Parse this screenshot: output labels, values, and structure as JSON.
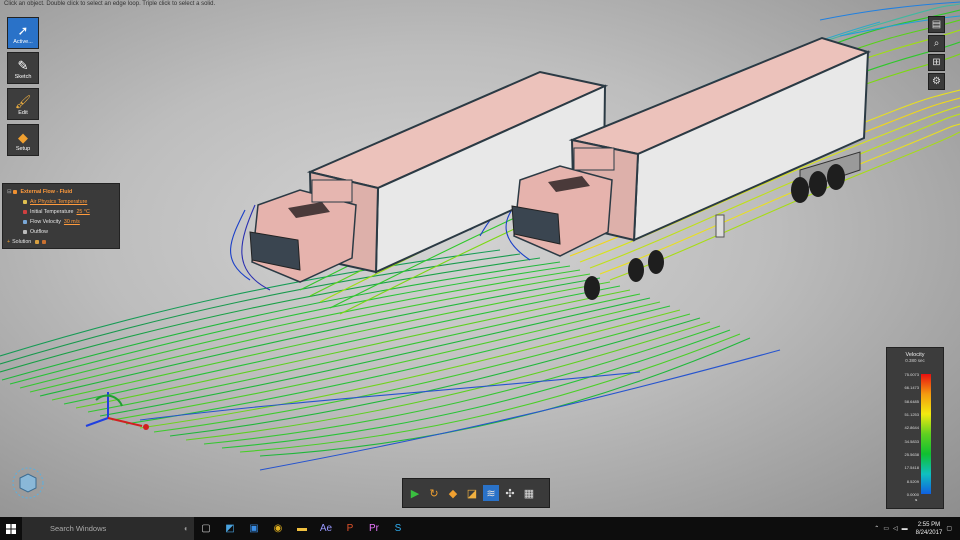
{
  "status_hint": "Click an object. Double click to select an edge loop. Triple click to select a solid.",
  "tools": [
    {
      "label": "Active...",
      "icon": "cursor-icon"
    },
    {
      "label": "Sketch",
      "icon": "pencil-icon"
    },
    {
      "label": "Edit",
      "icon": "brush-icon"
    },
    {
      "label": "Setup",
      "icon": "setup-icon"
    }
  ],
  "tree": {
    "title": "External Flow - Fluid",
    "link": "Air Physics Temperature",
    "rows": [
      {
        "label": "Initial Temperature",
        "value": "25 °C"
      },
      {
        "label": "Flow Velocity",
        "value": "30 m/s"
      },
      {
        "label": "Outflow",
        "value": ""
      }
    ],
    "solution": "Solution"
  },
  "legend": {
    "title": "Velocity",
    "subtitle": "0.380 sec",
    "ticks": [
      "75.0073",
      "66.1473",
      "58.6485",
      "51.1253",
      "42.8644",
      "34.5833",
      "25.5638",
      "17.5418",
      "8.5209",
      "0.0000"
    ]
  },
  "taskbar": {
    "search_placeholder": "Search Windows",
    "time": "2:55 PM",
    "date": "8/24/2017",
    "apps": [
      {
        "name": "task-view-icon",
        "glyph": "▢",
        "color": "#cccccc"
      },
      {
        "name": "discovery-app-icon",
        "glyph": "◩",
        "color": "#4aa3df"
      },
      {
        "name": "store-icon",
        "glyph": "▣",
        "color": "#3a8ee6"
      },
      {
        "name": "chrome-icon",
        "glyph": "◉",
        "color": "#e0b020"
      },
      {
        "name": "file-explorer-icon",
        "glyph": "▬",
        "color": "#f0c040"
      },
      {
        "name": "after-effects-icon",
        "glyph": "Ae",
        "color": "#9999ff"
      },
      {
        "name": "powerpoint-icon",
        "glyph": "P",
        "color": "#e0522a"
      },
      {
        "name": "premiere-icon",
        "glyph": "Pr",
        "color": "#ea77ff"
      },
      {
        "name": "skype-icon",
        "glyph": "S",
        "color": "#30aef0"
      }
    ]
  },
  "colors": {
    "accent": "#2a72c8",
    "link": "#ff9a3c",
    "trailer": "#f2c8c2"
  }
}
